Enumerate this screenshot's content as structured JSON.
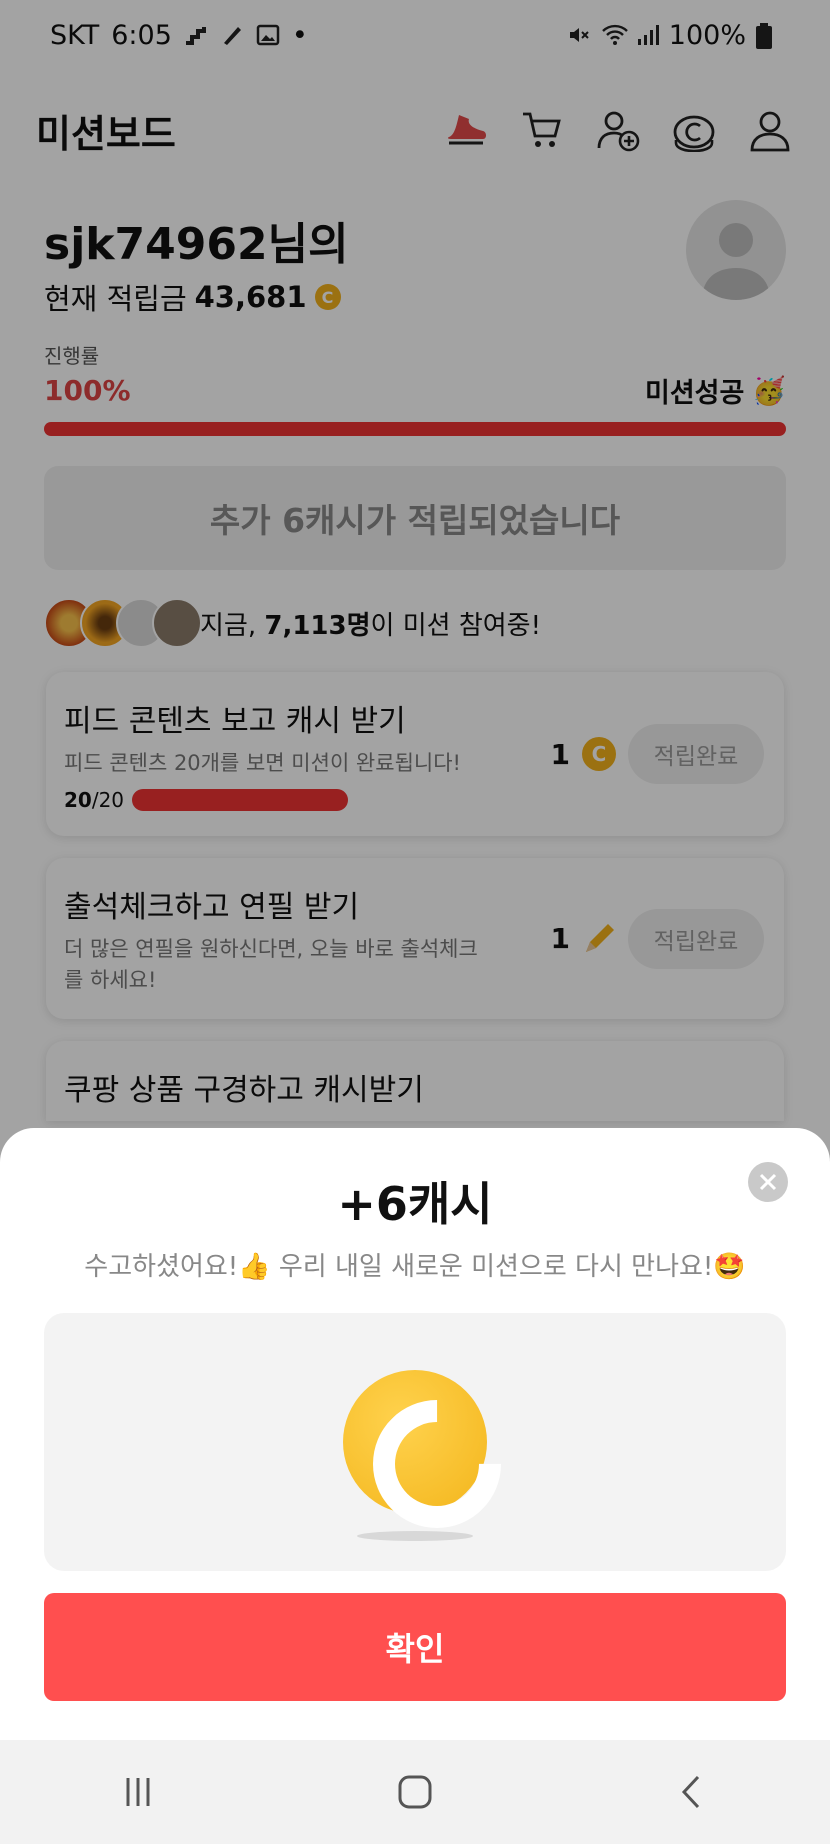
{
  "status_bar": {
    "carrier": "SKT",
    "time": "6:05",
    "battery": "100%"
  },
  "header": {
    "title": "미션보드"
  },
  "profile": {
    "greeting": "sjk74962님의",
    "balance_label": "현재 적립금",
    "balance_value": "43,681",
    "coin_symbol": "C"
  },
  "progress": {
    "label": "진행률",
    "value": "100%",
    "status": "미션성공",
    "fraction": 1.0
  },
  "bonus_text": "추가 6캐시가 적립되었습니다",
  "participants": {
    "prefix": "지금,",
    "count": "7,113명",
    "suffix": "이 미션 참여중!"
  },
  "missions": [
    {
      "title": "피드 콘텐츠 보고 캐시 받기",
      "description": "피드 콘텐츠 20개를 보면 미션이 완료됩니다!",
      "progress_current": "20",
      "progress_total": "/20",
      "reward": "1",
      "reward_icon": "coin-icon",
      "button": "적립완료"
    },
    {
      "title": "출석체크하고 연필 받기",
      "description": "더 많은 연필을 원하신다면, 오늘 바로 출석체크를 하세요!",
      "reward": "1",
      "reward_icon": "pencil-icon",
      "button": "적립완료"
    },
    {
      "title": "쿠팡 상품 구경하고 캐시받기"
    }
  ],
  "modal": {
    "title": "+6캐시",
    "subtitle": "수고하셨어요!👍 우리 내일 새로운 미션으로 다시 만나요!🤩",
    "confirm": "확인"
  },
  "colors": {
    "accent": "#ff4f4f",
    "coin": "#f2b11b",
    "progress": "#e33333"
  }
}
